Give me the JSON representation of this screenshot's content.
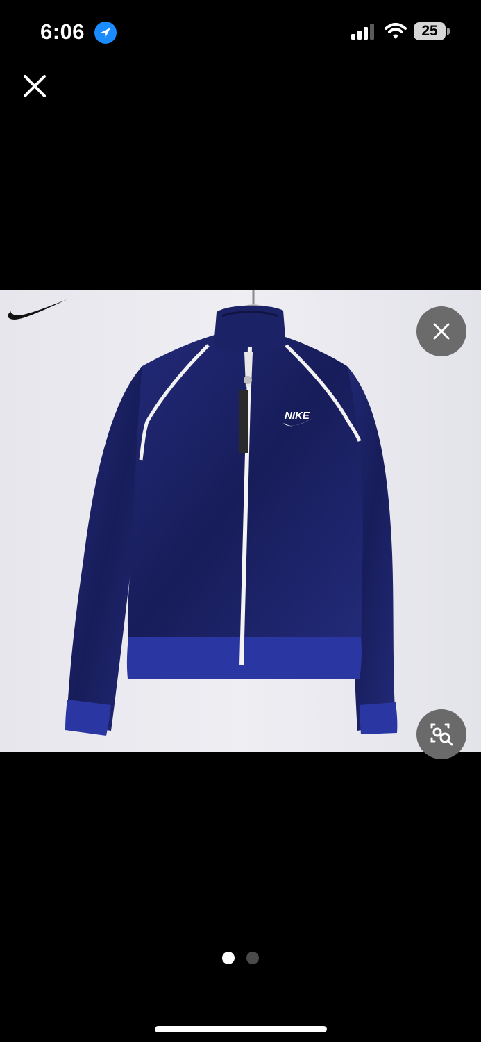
{
  "status_bar": {
    "time": "6:06",
    "battery_level": "25",
    "icons": [
      "location-arrow-icon",
      "cellular-signal-icon",
      "wifi-icon",
      "battery-icon"
    ]
  },
  "viewer": {
    "close_icon": "close-icon",
    "photo": {
      "brand_logo": "swoosh-logo",
      "jacket_logo_text": "NIKE",
      "colors": {
        "jacket": "#1c2366",
        "background": "#e9e9ef",
        "piping": "#f2f2f2"
      }
    },
    "photo_close_icon": "close-icon",
    "visual_lookup_icon": "visual-lookup-icon",
    "pagination": {
      "total": 2,
      "current": 1
    }
  },
  "home_indicator": "home-indicator"
}
